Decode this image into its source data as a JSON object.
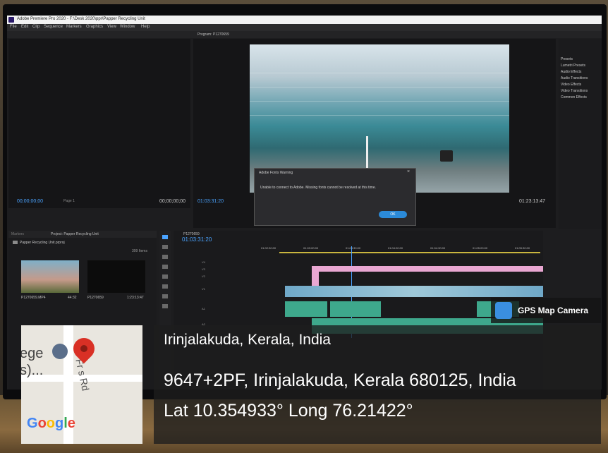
{
  "app": {
    "title": "Adobe Premiere Pro 2020 - F:\\Desk 2020\\ppr\\Papper Recycling Unit",
    "menus": [
      "File",
      "Edit",
      "Clip",
      "Sequence",
      "Markers",
      "Graphics",
      "View",
      "Window",
      "Help"
    ]
  },
  "source_monitor": {
    "timecode_in": "00;00;00;00",
    "page": "Page 1",
    "timecode_out": "00;00;00;00"
  },
  "program_monitor": {
    "tab": "Program: P1270659",
    "timecode": "01:03:31:20",
    "duration": "01:23:13:47"
  },
  "dialog": {
    "title": "Adobe Fonts Warning",
    "message": "Unable to connect to Adobe. Missing fonts cannot be resolved at this time.",
    "ok_label": "OK"
  },
  "effects": {
    "items": [
      "Presets",
      "Lumetri Presets",
      "Audio Effects",
      "Audio Transitions",
      "Video Effects",
      "Video Transitions",
      "Common Effects"
    ]
  },
  "project": {
    "tabs": [
      "Markers",
      "Project: Papper Recycling Unit"
    ],
    "name": "Papper Recycling Unit.prproj",
    "item_count": "399 Items",
    "items": [
      {
        "name": "P1270659.MP4",
        "duration": "44:32"
      },
      {
        "name": "P1270659",
        "duration": "1:23:13:47"
      }
    ]
  },
  "timeline": {
    "tab": "P1270659",
    "timecode": "01:03:31:20",
    "ruler": [
      "01:02:30:00",
      "01:03:00:00",
      "01:03:30:00",
      "01:04:00:00",
      "01:04:30:00",
      "01:05:00:00",
      "01:05:30:00"
    ],
    "tracks": [
      "V4",
      "V3",
      "V2",
      "V1",
      "A1",
      "A2"
    ]
  },
  "gps": {
    "badge": "GPS Map Camera",
    "place": "Irinjalakuda, Kerala, India",
    "address": "9647+2PF, Irinjalakuda, Kerala 680125, India",
    "coords": "Lat 10.354933° Long 76.21422°",
    "map_label_1": "ege",
    "map_label_2": "s)...",
    "map_road": "Fr    s Rd",
    "map_brand": "Google"
  },
  "colors": {
    "accent_blue": "#4aa3ff",
    "pin_red": "#d93025"
  }
}
